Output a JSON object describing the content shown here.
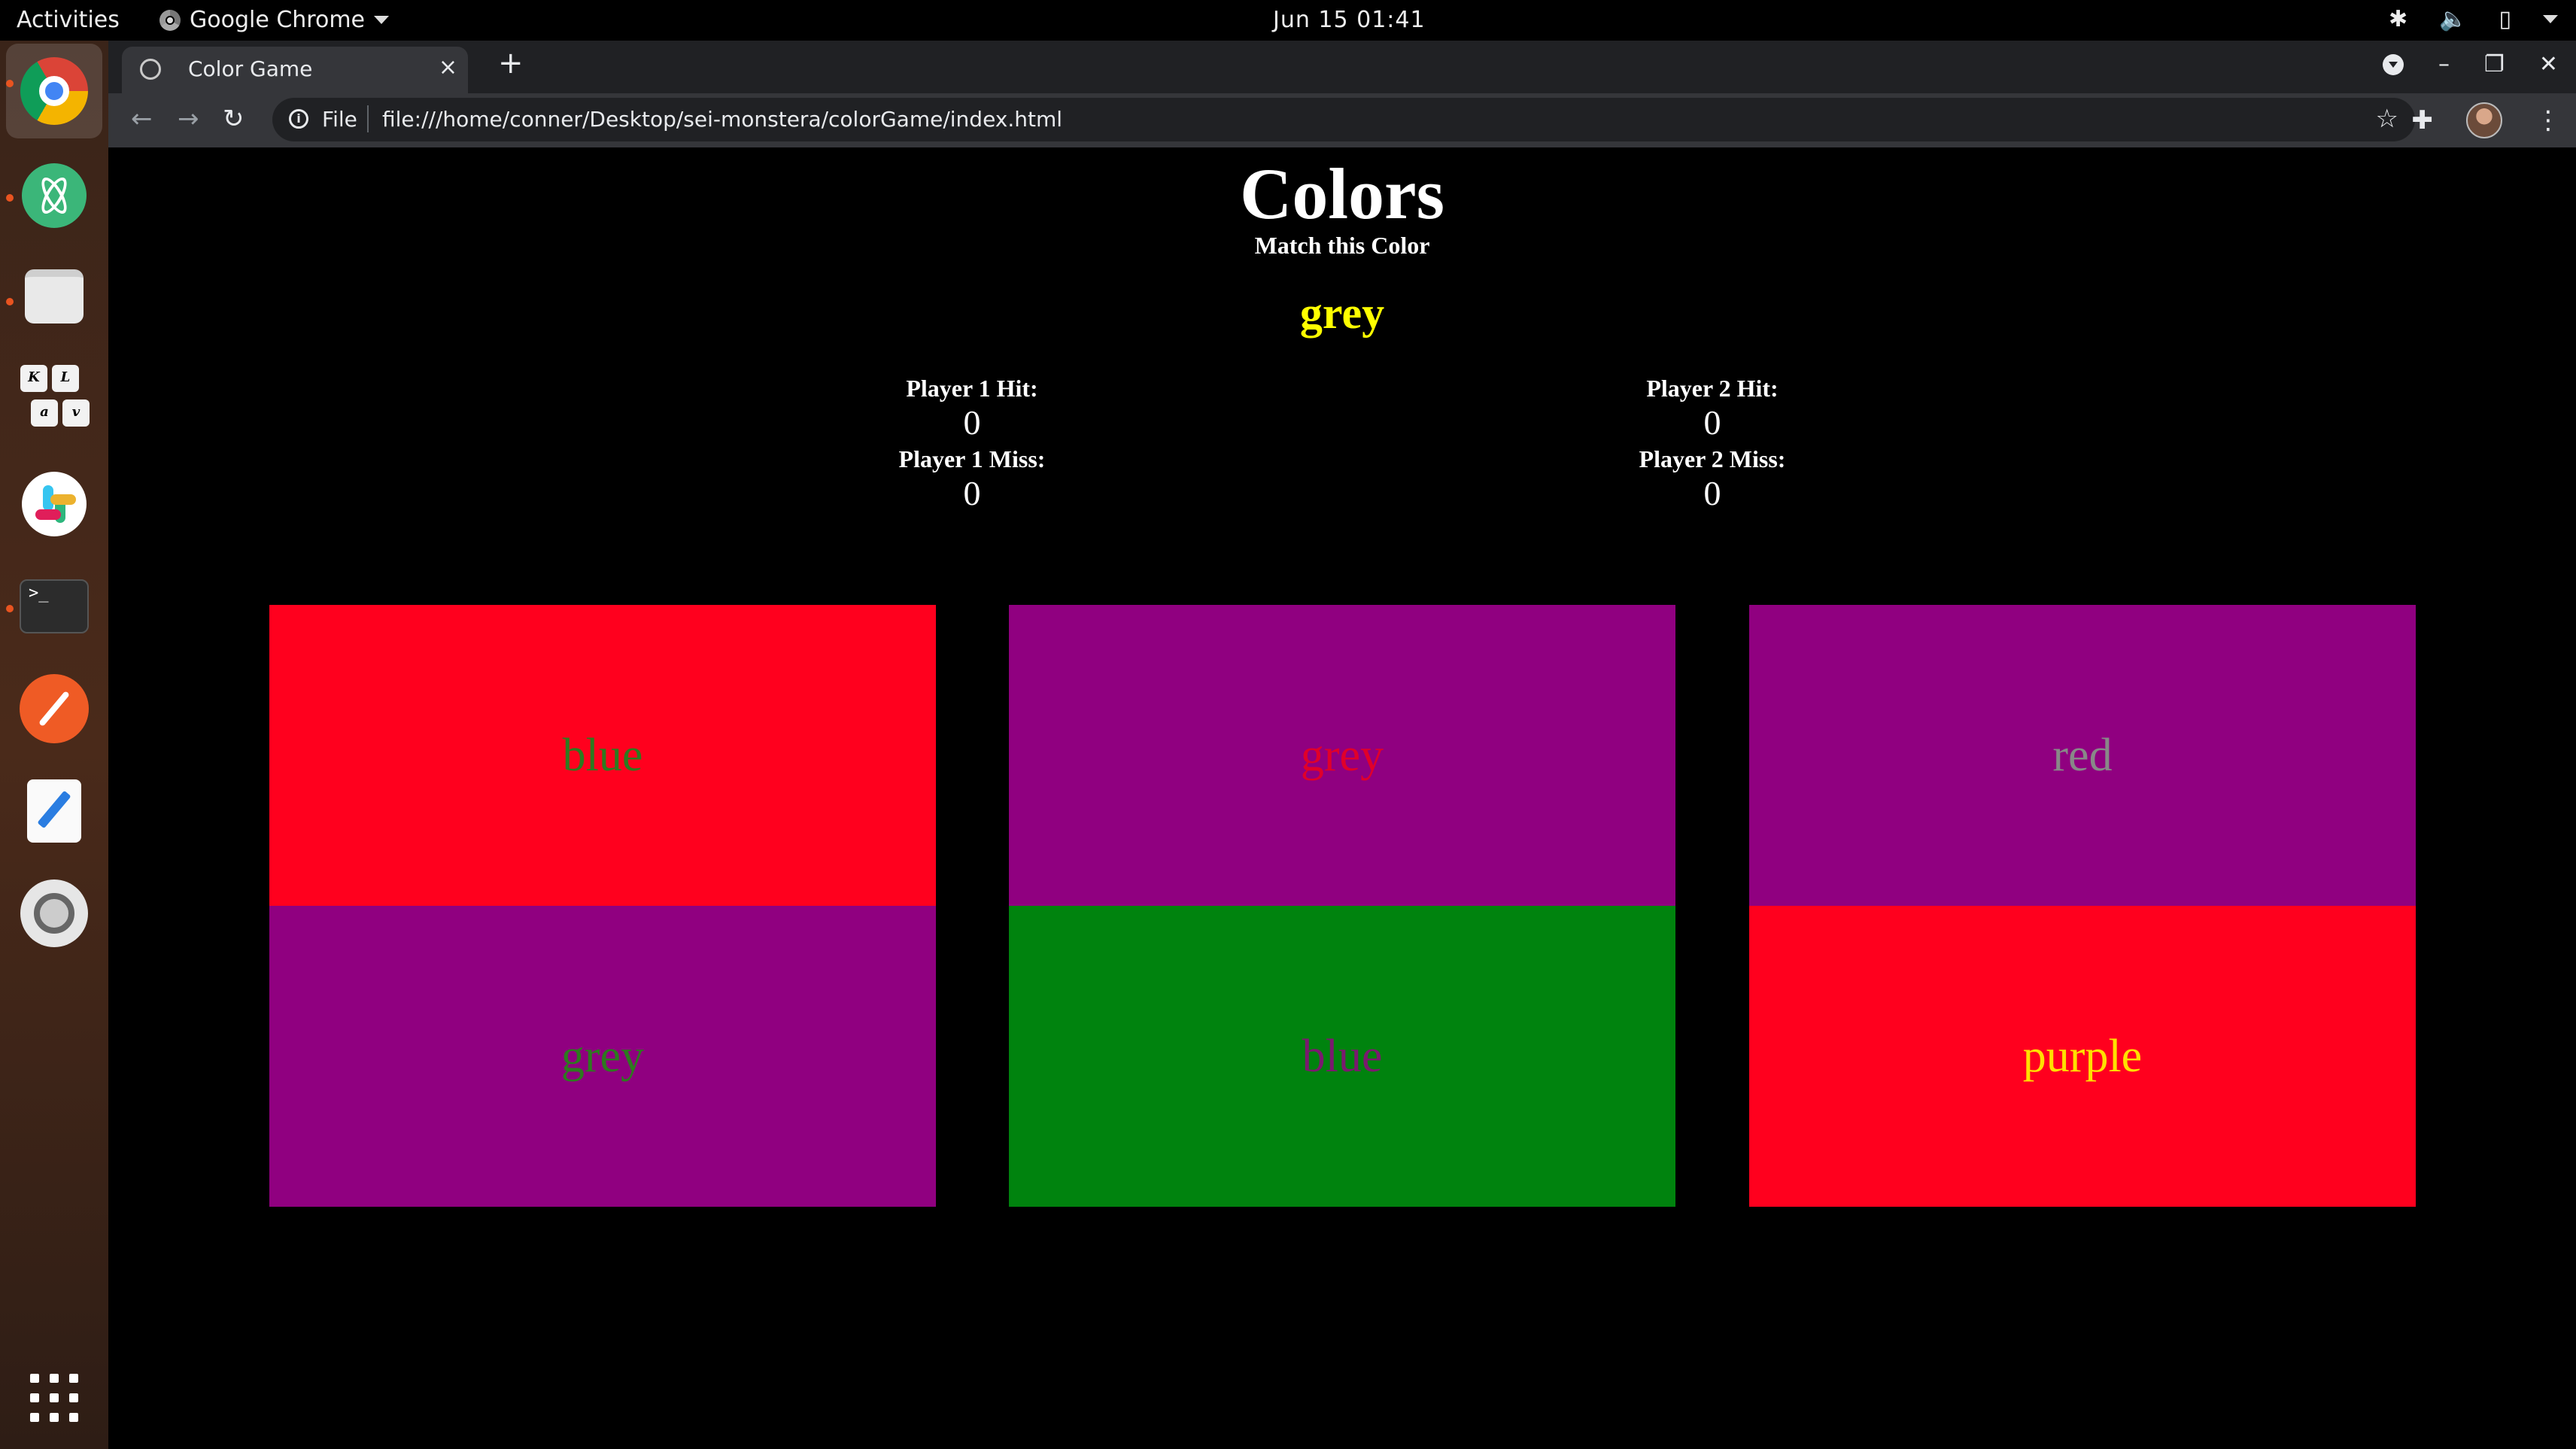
{
  "topbar": {
    "activities": "Activities",
    "app_name": "Google Chrome",
    "clock": "Jun 15  01:41"
  },
  "browser": {
    "tab_title": "Color Game",
    "new_tab": "+",
    "close_tab": "×",
    "scheme_label": "File",
    "url": "file:///home/conner/Desktop/sei-monstera/colorGame/index.html"
  },
  "game": {
    "title": "Colors",
    "subtitle": "Match this Color",
    "target_word": "grey",
    "player1": {
      "hit_label": "Player 1 Hit:",
      "hit": "0",
      "miss_label": "Player 1 Miss:",
      "miss": "0"
    },
    "player2": {
      "hit_label": "Player 2 Hit:",
      "hit": "0",
      "miss_label": "Player 2 Miss:",
      "miss": "0"
    },
    "cards": [
      {
        "word": "blue",
        "bg": "#ff001e",
        "fg": "#2d7a1f"
      },
      {
        "word": "grey",
        "bg": "#900080",
        "fg": "#2d7a1f"
      },
      {
        "word": "grey",
        "bg": "#900080",
        "fg": "#e0002a"
      },
      {
        "word": "blue",
        "bg": "#00830e",
        "fg": "#7a1a6e"
      },
      {
        "word": "red",
        "bg": "#900080",
        "fg": "#888888"
      },
      {
        "word": "purple",
        "bg": "#ff001e",
        "fg": "#ffe000"
      }
    ]
  }
}
